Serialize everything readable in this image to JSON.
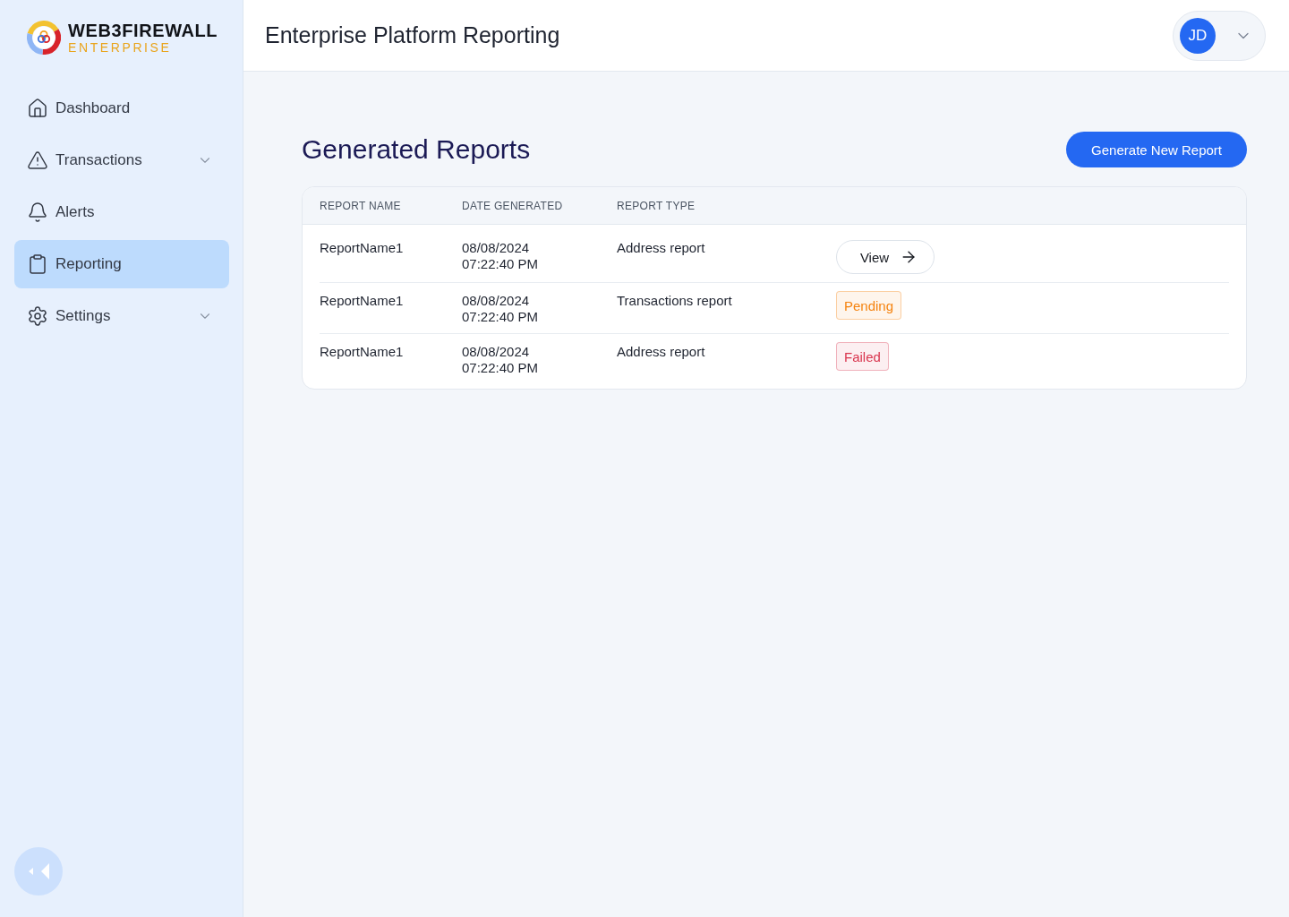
{
  "sidebar": {
    "brand": {
      "name": "WEB3FIREWALL",
      "tagline": "ENTERPRISE"
    },
    "items": [
      {
        "label": "Dashboard",
        "kind": "link",
        "selected": false
      },
      {
        "label": "Transactions",
        "kind": "group",
        "expanded": false,
        "selected": false
      },
      {
        "label": "Alerts",
        "kind": "link",
        "selected": false
      },
      {
        "label": "Reporting",
        "kind": "link",
        "selected": true
      },
      {
        "label": "Settings",
        "kind": "group",
        "expanded": false,
        "selected": false
      }
    ]
  },
  "header": {
    "title": "Enterprise Platform Reporting",
    "user": {
      "initials": "JD"
    }
  },
  "reports": {
    "title": "Generated Reports",
    "action": "Generate New Report",
    "table": {
      "columns": [
        "REPORT NAME",
        "DATE GENERATED",
        "REPORT TYPE"
      ],
      "rows": [
        {
          "report_name": "ReportName1",
          "date_generated": "08/08/2024 07:22:40 PM",
          "report_type": "Address report",
          "column_4": {
            "kind": "button",
            "label": "View"
          }
        },
        {
          "report_name": "ReportName1",
          "date_generated": "08/08/2024 07:22:40 PM",
          "report_type": "Transactions report",
          "column_4": {
            "kind": "badge",
            "label": "Pending",
            "color": "#f5830f"
          }
        },
        {
          "report_name": "ReportName1",
          "date_generated": "08/08/2024 07:22:40 PM",
          "report_type": "Address report",
          "column_4": {
            "kind": "badge",
            "label": "Failed",
            "color": "#d9364f"
          }
        }
      ]
    }
  }
}
